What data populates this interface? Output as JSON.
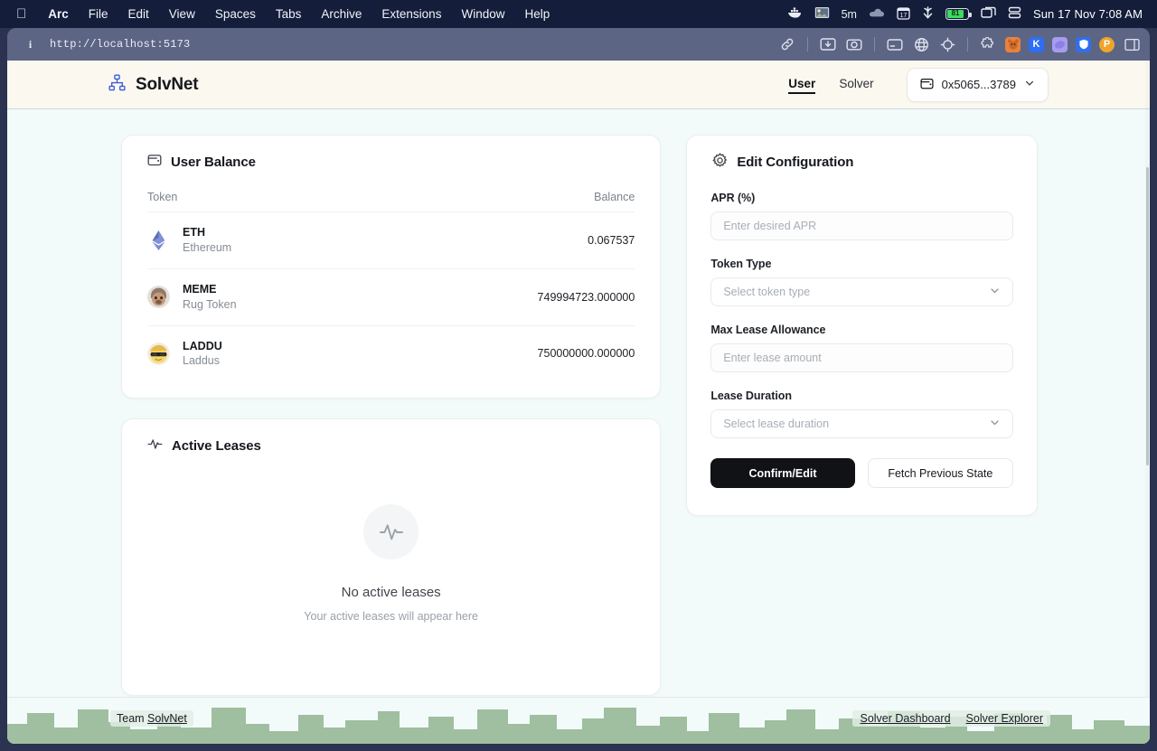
{
  "os_menubar": {
    "apple_icon": "apple-logo-icon",
    "items": [
      {
        "label": "Arc",
        "bold": true
      },
      {
        "label": "File",
        "bold": false
      },
      {
        "label": "Edit",
        "bold": false
      },
      {
        "label": "View",
        "bold": false
      },
      {
        "label": "Spaces",
        "bold": false
      },
      {
        "label": "Tabs",
        "bold": false
      },
      {
        "label": "Archive",
        "bold": false
      },
      {
        "label": "Extensions",
        "bold": false
      },
      {
        "label": "Window",
        "bold": false
      },
      {
        "label": "Help",
        "bold": false
      }
    ],
    "status": {
      "docker_icon": "docker-whale-icon",
      "weather_icon": "weather-photo-icon",
      "timer_text": "5m",
      "cloud_icon": "cloud-icon",
      "calendar_icon": "calendar-17-icon",
      "download_icon": "download-arrow-icon",
      "battery_level": "81",
      "screens_icon": "screen-mirroring-icon",
      "database_icon": "database-icon",
      "clock": "Sun 17 Nov  7:08 AM"
    }
  },
  "browser": {
    "info_icon": "info-icon",
    "url": "http://localhost:5173",
    "toolbar_icons": [
      "link-icon",
      "image-download-icon",
      "camera-icon",
      "card-icon",
      "globe-icon",
      "target-icon",
      "puzzle-extension-icon"
    ],
    "extensions": [
      {
        "name": "bear-extension-icon",
        "glyph": "●",
        "bg": "#e8833a"
      },
      {
        "name": "kagi-extension-icon",
        "glyph": "K",
        "bg": "#2e6df6"
      },
      {
        "name": "ghost-extension-icon",
        "glyph": "◑",
        "bg": "#a79cf0"
      },
      {
        "name": "bitwarden-extension-icon",
        "glyph": "■",
        "bg": "#2f6fed"
      },
      {
        "name": "proton-extension-icon",
        "glyph": "P",
        "bg": "#f0a52a"
      }
    ],
    "sidebar_toggle_icon": "sidebar-toggle-icon"
  },
  "app": {
    "logo_icon": "network-hierarchy-icon",
    "brand": "SolvNet",
    "nav": [
      {
        "label": "User",
        "active": true
      },
      {
        "label": "Solver",
        "active": false
      }
    ],
    "wallet": {
      "icon": "wallet-icon",
      "address": "0x5065...3789",
      "chevron": "chevron-down-icon"
    }
  },
  "user_balance": {
    "icon": "wallet-icon",
    "title": "User Balance",
    "columns": {
      "token": "Token",
      "balance": "Balance"
    },
    "rows": [
      {
        "symbol": "ETH",
        "name": "Ethereum",
        "balance": "0.067537",
        "icon": "ethereum-logo-icon"
      },
      {
        "symbol": "MEME",
        "name": "Rug Token",
        "balance": "749994723.000000",
        "icon": "meme-avatar-icon"
      },
      {
        "symbol": "LADDU",
        "name": "Laddus",
        "balance": "750000000.000000",
        "icon": "laddu-avatar-icon"
      }
    ]
  },
  "active_leases": {
    "icon": "activity-pulse-icon",
    "title": "Active Leases",
    "empty_icon": "activity-pulse-icon",
    "empty_title": "No active leases",
    "empty_subtitle": "Your active leases will appear here"
  },
  "edit_configuration": {
    "icon": "gear-icon",
    "title": "Edit Configuration",
    "fields": [
      {
        "label": "APR (%)",
        "type": "input",
        "value": "",
        "placeholder": "Enter desired APR"
      },
      {
        "label": "Token Type",
        "type": "select",
        "value": "",
        "placeholder": "Select token type"
      },
      {
        "label": "Max Lease Allowance",
        "type": "input",
        "value": "",
        "placeholder": "Enter lease amount"
      },
      {
        "label": "Lease Duration",
        "type": "select",
        "value": "",
        "placeholder": "Select lease duration"
      }
    ],
    "primary_button": "Confirm/Edit",
    "secondary_button": "Fetch Previous State"
  },
  "footer": {
    "team_prefix": "Team ",
    "team_brand": "SolvNet",
    "links": [
      "Solver Dashboard",
      "Solver Explorer"
    ]
  },
  "colors": {
    "menubar_bg": "#141d3a",
    "browser_chrome": "#5d6585",
    "page_bg": "#f2fbfa",
    "header_bg": "#fbf8ef",
    "card_bg": "#ffffff",
    "accent_dark": "#111216",
    "skyline_green": "#9fbfa0",
    "logo_blue": "#3b5bdb"
  }
}
